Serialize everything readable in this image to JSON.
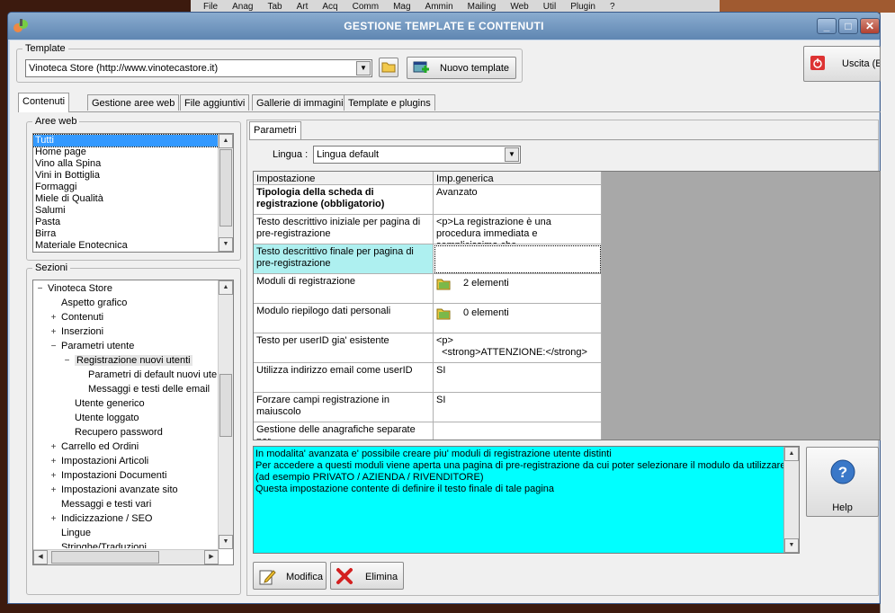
{
  "background_menu": [
    "File",
    "Anag",
    "Tab",
    "Art",
    "Acq",
    "Comm",
    "Mag",
    "Ammin",
    "Mailing",
    "Web",
    "Util",
    "Plugin",
    "?"
  ],
  "window": {
    "title": "GESTIONE TEMPLATE E CONTENUTI",
    "min": "_",
    "max": "□",
    "close": "✕"
  },
  "template": {
    "legend": "Template",
    "value": "Vinoteca Store (http://www.vinotecastore.it)",
    "new_button": "Nuovo template"
  },
  "exit_button": "Uscita (ES",
  "tabs": [
    "Contenuti",
    "Gestione aree web",
    "File aggiuntivi",
    "Gallerie di immagini",
    "Template e plugins"
  ],
  "aree_web": {
    "legend": "Aree web",
    "items": [
      "Tutti",
      "Home page",
      "Vino alla Spina",
      "Vini in Bottiglia",
      "Formaggi",
      "Miele di Qualità",
      "Salumi",
      "Pasta",
      "Birra",
      "Materiale Enotecnica"
    ],
    "selected": 0
  },
  "sezioni": {
    "legend": "Sezioni",
    "root": "Vinoteca Store",
    "nodes": [
      {
        "label": "Aspetto grafico",
        "level": 1,
        "exp": ""
      },
      {
        "label": "Contenuti",
        "level": 1,
        "exp": "+"
      },
      {
        "label": "Inserzioni",
        "level": 1,
        "exp": "+"
      },
      {
        "label": "Parametri utente",
        "level": 1,
        "exp": "−"
      },
      {
        "label": "Registrazione nuovi utenti",
        "level": 2,
        "exp": "−",
        "selected": true
      },
      {
        "label": "Parametri di default nuovi ute",
        "level": 3,
        "exp": ""
      },
      {
        "label": "Messaggi e testi delle email",
        "level": 3,
        "exp": ""
      },
      {
        "label": "Utente generico",
        "level": 2,
        "exp": ""
      },
      {
        "label": "Utente loggato",
        "level": 2,
        "exp": ""
      },
      {
        "label": "Recupero password",
        "level": 2,
        "exp": ""
      },
      {
        "label": "Carrello ed Ordini",
        "level": 1,
        "exp": "+"
      },
      {
        "label": "Impostazioni Articoli",
        "level": 1,
        "exp": "+"
      },
      {
        "label": "Impostazioni Documenti",
        "level": 1,
        "exp": "+"
      },
      {
        "label": "Impostazioni avanzate sito",
        "level": 1,
        "exp": "+"
      },
      {
        "label": "Messaggi e testi vari",
        "level": 1,
        "exp": ""
      },
      {
        "label": "Indicizzazione / SEO",
        "level": 1,
        "exp": "+"
      },
      {
        "label": "Lingue",
        "level": 1,
        "exp": ""
      },
      {
        "label": "Stringhe/Traduzioni",
        "level": 1,
        "exp": ""
      }
    ]
  },
  "parametri": {
    "tab": "Parametri",
    "lingua_label": "Lingua :",
    "lingua_value": "Lingua default"
  },
  "grid": {
    "headers": [
      "Impostazione",
      "Imp.generica"
    ],
    "rows": [
      {
        "name": "Tipologia della scheda di registrazione (obbligatorio)",
        "value": "Avanzato",
        "bold": true
      },
      {
        "name": "Testo descrittivo iniziale per pagina di pre-registrazione",
        "value": "<p>La registrazione è una procedura immediata e semplicissima che"
      },
      {
        "name": "Testo descrittivo finale per pagina di pre-registrazione",
        "value": "",
        "highlight": true
      },
      {
        "name": "Moduli di registrazione",
        "value": "2 elementi",
        "icon": true
      },
      {
        "name": "Modulo riepilogo dati personali",
        "value": "0 elementi",
        "icon": true
      },
      {
        "name": "Testo per userID gia' esistente",
        "value": "<p>\n  <strong>ATTENZIONE:</strong>"
      },
      {
        "name": "Utilizza indirizzo email come userID",
        "value": "SI"
      },
      {
        "name": "Forzare campi registrazione in maiuscolo",
        "value": "SI"
      },
      {
        "name": "Gestione delle anagrafiche separate per",
        "value": ""
      }
    ]
  },
  "description": [
    "In modalita' avanzata e' possibile creare piu' moduli di registrazione utente distinti",
    "Per accedere a questi moduli viene aperta una pagina di pre-registrazione da cui poter selezionare il modulo da utilizzare",
    "(ad esempio PRIVATO / AZIENDA / RIVENDITORE)",
    "Questa impostazione contente di definire il testo finale di tale pagina"
  ],
  "buttons": {
    "modifica": "Modifica",
    "elimina": "Elimina",
    "help": "Help"
  },
  "colors": {
    "titlebar": "#6f92bc",
    "selection": "#3399ff",
    "description_bg": "#00ffff",
    "highlight_cell": "#aef0f0"
  }
}
